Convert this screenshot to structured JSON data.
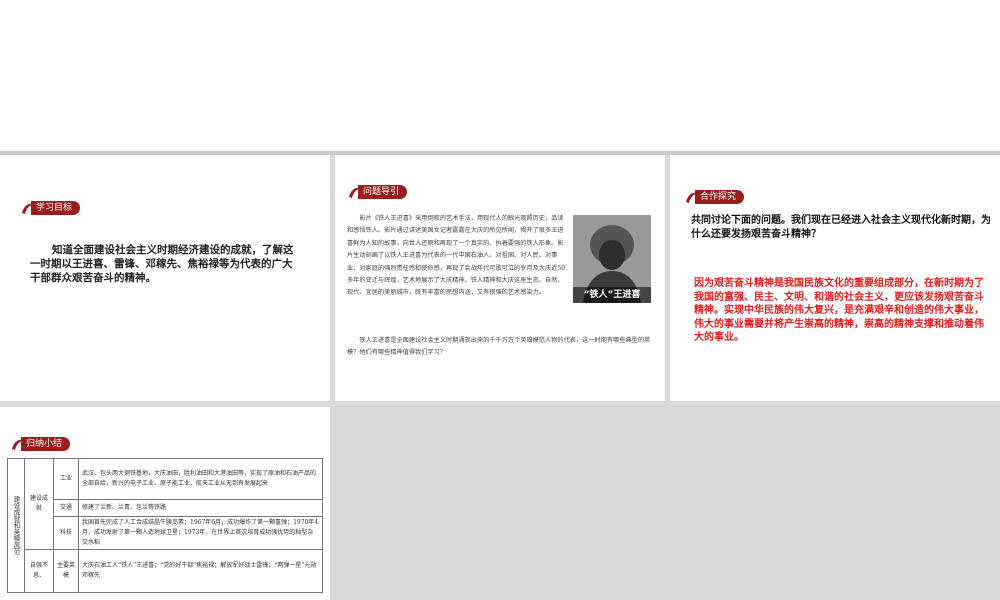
{
  "slide1": {
    "badge": "学习目标",
    "goal": "知道全面建设社会主义时期经济建设的成就，了解这一时期以王进喜、雷锋、邓稼先、焦裕禄等为代表的广大干部群众艰苦奋斗的精神。"
  },
  "slide2": {
    "badge": "问题导引",
    "photo_caption": "“铁人”王进喜",
    "para1": "影片《铁人王进喜》采用倒叙的艺术手法，用现代人的眼光观照历史，品读和感悟铁人。影片通过讲述美国女记者露露在大庆的所见所闻，揭开了很多王进喜鲜为人知的故事，向世人还原和再现了一个真实的、执着要强的铁人形象。影片生动刻画了以铁人王进喜为代表的一代中国石油人，对祖国、对人民、对事业、对家庭的强烈责任感和使命感，再现了会战年代可歌可泣的岁月及大庆近50多年的变迁与辉煌，艺术地展示了大庆精神、铁人精神和大庆这座生态、自然、现代、宜居的美丽城市，既有丰富的思想内涵，又有很强的艺术感染力。",
    "para2": "铁人王进喜是全面建设社会主义时期涌现出来的千千万万个英雄模范人物的代表，这一时期有哪些典型的英模？他们有哪些精神值得我们学习？"
  },
  "slide3": {
    "badge": "合作探究",
    "question": "共同讨论下面的问题。我们现在已经进入社会主义现代化新时期，为什么还要发扬艰苦奋斗精神？",
    "answer": "因为艰苦奋斗精神是我国民族文化的重要组成部分，在新时期为了我国的富强、民主、文明、和谐的社会主义，更应该发扬艰苦奋斗精神。实现中华民族的伟大复兴，是充满艰辛和创造的伟大事业，伟大的事业需要并将产生崇高的精神，崇高的精神支撑和推动着伟大的事业。"
  },
  "slide4": {
    "badge": "归纳小结",
    "outer_label": "建设成就和英模风范",
    "group1_label": "建设成就",
    "group2_label": "自强不息、",
    "rows": [
      {
        "sub": "工业",
        "text": "武汉、包头两大钢铁基地，大庆油田，胜利油田和大港油田等，实现了原油和石油产品的全部自给，新兴的电子工业、原子能工业、航天工业从无到有发展起来"
      },
      {
        "sub": "交通",
        "text": "修建了兰新、兰青、包兰等铁路"
      },
      {
        "sub": "科技",
        "text": "我国首先完成了人工合成结晶牛胰岛素；1967年6月，成功爆炸了第一颗氢弹；1970年4月，成功发射了第一颗人造地球卫星；1973年，在世界上首次培育成功强优势的籼型杂交水稻"
      },
      {
        "sub": "主要英模",
        "text": "大庆石油工人“铁人”王进喜；“党的好干部”焦裕禄；解放军好战士雷锋；“两弹一星”元勋邓稼先"
      }
    ]
  }
}
